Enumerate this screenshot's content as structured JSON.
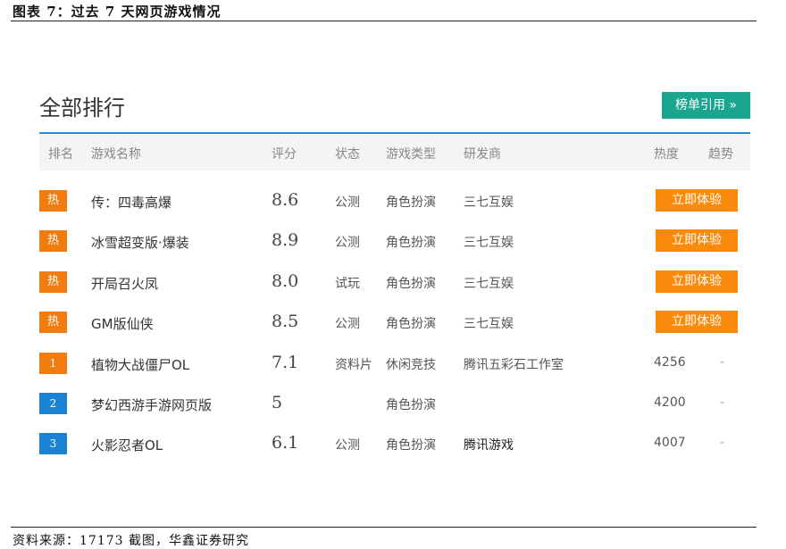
{
  "figure": {
    "title": "图表 7：过去 7 天网页游戏情况",
    "source": "资料来源：17173 截图，华鑫证券研究"
  },
  "panel": {
    "title": "全部排行",
    "cite_button": "榜单引用 »"
  },
  "table": {
    "headers": {
      "rank": "排名",
      "name": "游戏名称",
      "score": "评分",
      "status": "状态",
      "genre": "游戏类型",
      "developer": "研发商",
      "heat": "热度",
      "trend": "趋势"
    },
    "rows": [
      {
        "badge": "热",
        "badge_style": "hot",
        "name": "传：四毒高爆",
        "score": "8.6",
        "status": "公测",
        "genre": "角色扮演",
        "developer": "三七互娱",
        "action": "立即体验"
      },
      {
        "badge": "热",
        "badge_style": "hot",
        "name": "冰雪超变版·爆装",
        "score": "8.9",
        "status": "公测",
        "genre": "角色扮演",
        "developer": "三七互娱",
        "action": "立即体验"
      },
      {
        "badge": "热",
        "badge_style": "hot",
        "name": "开局召火凤",
        "score": "8.0",
        "status": "试玩",
        "genre": "角色扮演",
        "developer": "三七互娱",
        "action": "立即体验"
      },
      {
        "badge": "热",
        "badge_style": "hot",
        "name": "GM版仙侠",
        "score": "8.5",
        "status": "公测",
        "genre": "角色扮演",
        "developer": "三七互娱",
        "action": "立即体验"
      },
      {
        "badge": "1",
        "badge_style": "orange",
        "name": "植物大战僵尸OL",
        "score": "7.1",
        "status": "资料片",
        "genre": "休闲竞技",
        "developer": "腾讯五彩石工作室",
        "heat": "4256",
        "trend": "-"
      },
      {
        "badge": "2",
        "badge_style": "blue",
        "name": "梦幻西游手游网页版",
        "score": "5",
        "status": "",
        "genre": "角色扮演",
        "developer": "",
        "heat": "4200",
        "trend": "-"
      },
      {
        "badge": "3",
        "badge_style": "blue",
        "name": "火影忍者OL",
        "score": "6.1",
        "status": "公测",
        "genre": "角色扮演",
        "developer": "腾讯游戏",
        "heat": "4007",
        "trend": "-"
      }
    ]
  },
  "colors": {
    "hot_badge": "#f07c10",
    "rank_blue": "#1b83d4",
    "cite_button": "#1aa58e",
    "play_button": "#f98a0c",
    "header_line": "#2a8bd0"
  }
}
